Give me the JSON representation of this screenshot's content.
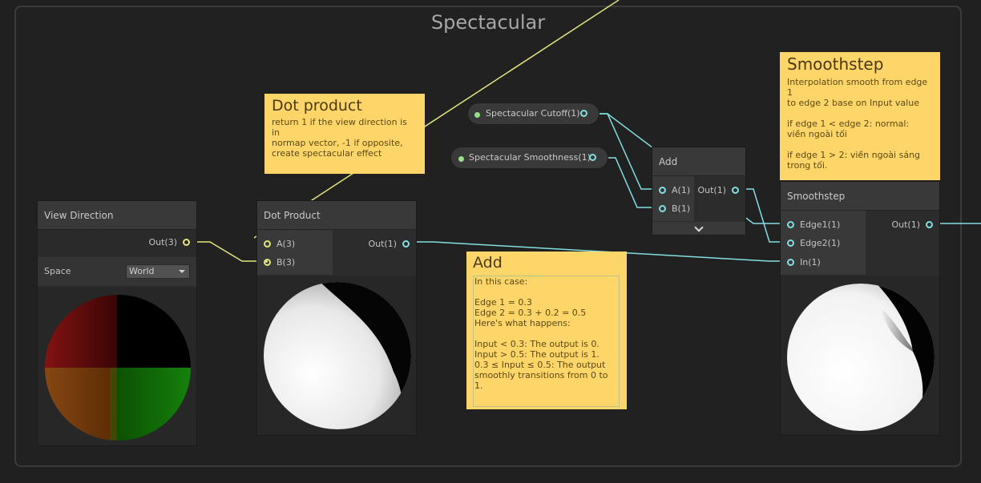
{
  "group": {
    "title": "Spectacular"
  },
  "view_direction": {
    "title": "View Direction",
    "out_label": "Out(3)",
    "space_label": "Space",
    "space_value": "World"
  },
  "dot_product_node": {
    "title": "Dot Product",
    "in_a": "A(3)",
    "in_b": "B(3)",
    "out": "Out(1)"
  },
  "add_node": {
    "title": "Add",
    "in_a": "A(1)",
    "in_b": "B(1)",
    "out": "Out(1)"
  },
  "smoothstep_node": {
    "title": "Smoothstep",
    "in_edge1": "Edge1(1)",
    "in_edge2": "Edge2(1)",
    "in_in": "In(1)",
    "out": "Out(1)"
  },
  "properties": {
    "cutoff": "Spectacular Cutoff(1)",
    "smoothness": "Spectacular Smoothness(1)"
  },
  "notes": {
    "dot": {
      "title": "Dot product",
      "body": "return 1 if the view direction is in\nnormap vector, -1 if opposite,\ncreate spectacular effect"
    },
    "add": {
      "title": "Add",
      "body": "In this case:\n\nEdge 1 = 0.3\nEdge 2 = 0.3 + 0.2 = 0.5\nHere's what happens:\n\nInput < 0.3: The output is 0.\nInput > 0.5: The output is 1.\n0.3 ≤ Input ≤ 0.5: The output\nsmoothly transitions from 0 to 1."
    },
    "smoothstep": {
      "title": "Smoothstep",
      "body": "Interpolation smooth from edge 1\nto edge 2 base on Input value\n\nif edge 1 < edge 2: normal:\nviền ngoài tối\n\nif edge 1 > 2: viền ngoài sáng\ntrong tối."
    }
  },
  "colors": {
    "vector3_wire": "#e3e57d",
    "float_wire": "#83dee2",
    "sticky": "#fdd568"
  }
}
